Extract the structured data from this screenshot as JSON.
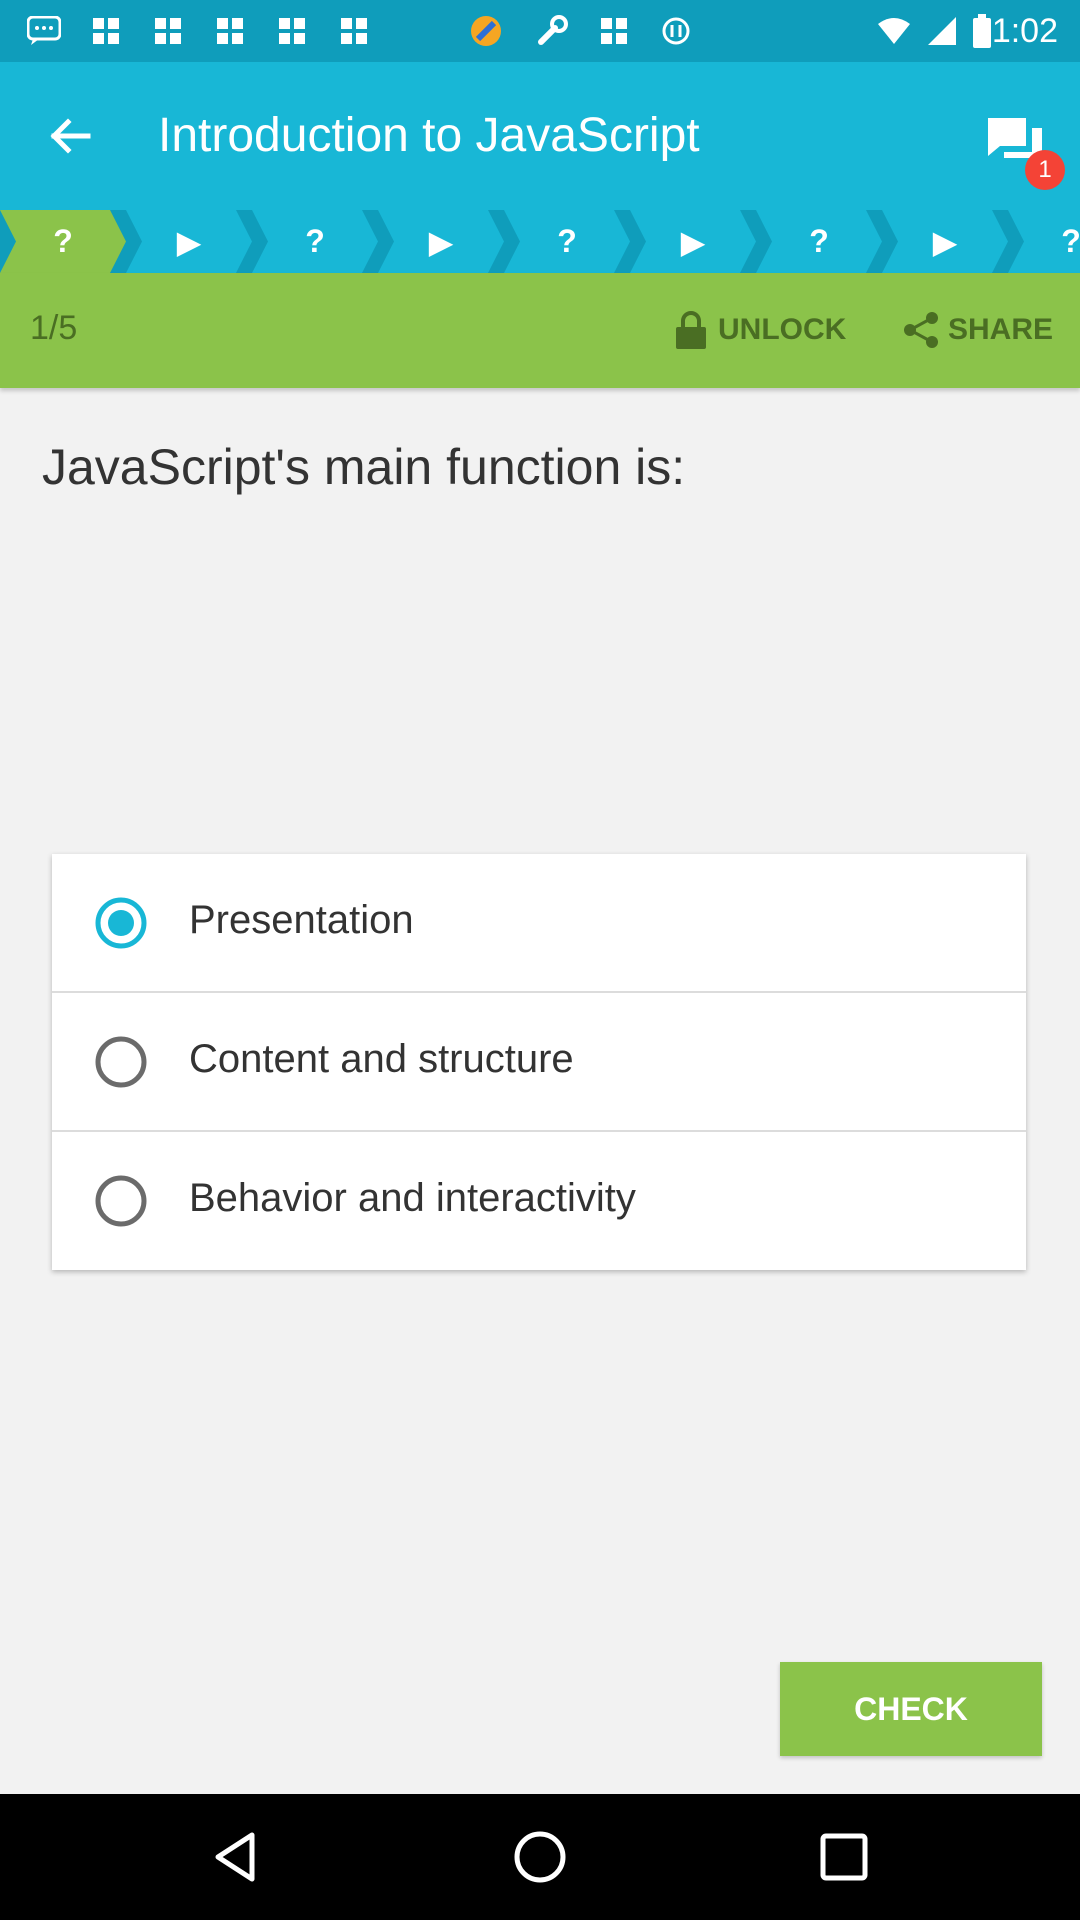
{
  "status_bar": {
    "time": "1:02",
    "icons": [
      "chat-bubble-icon",
      "grid-icon",
      "grid-icon",
      "grid-icon",
      "grid-icon",
      "app-logo-icon",
      "wrench-icon",
      "grid-icon",
      "sync-icon"
    ]
  },
  "app_bar": {
    "title": "Introduction to JavaScript",
    "notification_count": "1",
    "color": "#18b7d6"
  },
  "steps": [
    {
      "type": "question",
      "glyph": "?",
      "active": true
    },
    {
      "type": "play",
      "glyph": "▶",
      "active": false
    },
    {
      "type": "question",
      "glyph": "?",
      "active": false
    },
    {
      "type": "play",
      "glyph": "▶",
      "active": false
    },
    {
      "type": "question",
      "glyph": "?",
      "active": false
    },
    {
      "type": "play",
      "glyph": "▶",
      "active": false
    },
    {
      "type": "question",
      "glyph": "?",
      "active": false
    },
    {
      "type": "play",
      "glyph": "▶",
      "active": false
    },
    {
      "type": "question",
      "glyph": "?",
      "active": false
    }
  ],
  "lesson_bar": {
    "progress": "1/5",
    "unlock_label": "UNLOCK",
    "share_label": "SHARE",
    "color": "#8bc34a"
  },
  "question": "JavaScript's main function is:",
  "options": [
    {
      "label": "Presentation",
      "selected": true
    },
    {
      "label": "Content and structure",
      "selected": false
    },
    {
      "label": "Behavior and interactivity",
      "selected": false
    }
  ],
  "check_label": "CHECK"
}
